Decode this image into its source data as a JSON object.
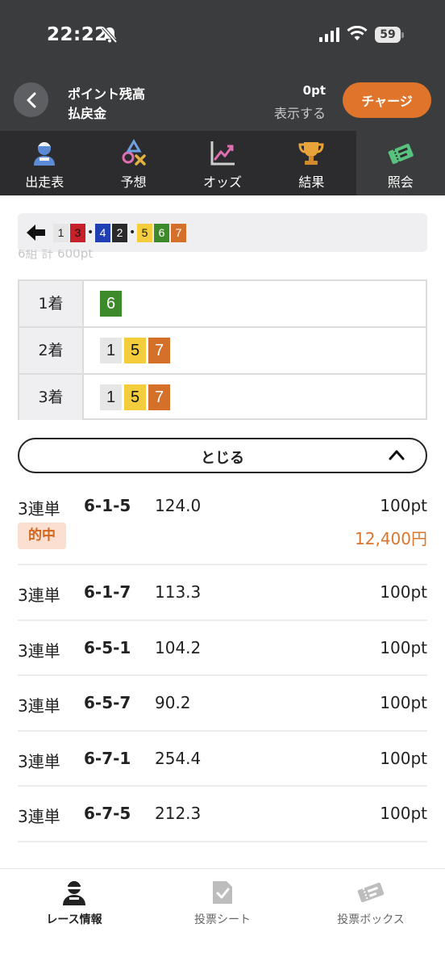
{
  "status_bar": {
    "time": "22:22",
    "battery": "59"
  },
  "header": {
    "point_label": "ポイント残高",
    "payout_label": "払戻金",
    "point_value": "0pt",
    "show_link": "表示する",
    "charge_button": "チャージ"
  },
  "tabs": [
    {
      "label": "出走表",
      "icon": "racer-icon"
    },
    {
      "label": "予想",
      "icon": "prediction-icon"
    },
    {
      "label": "オッズ",
      "icon": "odds-chart-icon"
    },
    {
      "label": "結果",
      "icon": "trophy-icon"
    },
    {
      "label": "照会",
      "icon": "ticket-icon",
      "active": true
    }
  ],
  "combo_bar": {
    "chips": [
      "1",
      "3",
      "4",
      "2",
      "5",
      "6",
      "7"
    ],
    "faded_text": "6組 計 600pt"
  },
  "results": {
    "rows": [
      {
        "place": "1着",
        "numbers": [
          "6"
        ]
      },
      {
        "place": "2着",
        "numbers": [
          "1",
          "5",
          "7"
        ]
      },
      {
        "place": "3着",
        "numbers": [
          "1",
          "5",
          "7"
        ]
      }
    ]
  },
  "close_button": "とじる",
  "bets": [
    {
      "type": "3連単",
      "combo": "6-1-5",
      "odds": "124.0",
      "amount": "100pt",
      "hit_label": "的中",
      "payout": "12,400円"
    },
    {
      "type": "3連単",
      "combo": "6-1-7",
      "odds": "113.3",
      "amount": "100pt"
    },
    {
      "type": "3連単",
      "combo": "6-5-1",
      "odds": "104.2",
      "amount": "100pt"
    },
    {
      "type": "3連単",
      "combo": "6-5-7",
      "odds": "90.2",
      "amount": "100pt"
    },
    {
      "type": "3連単",
      "combo": "6-7-1",
      "odds": "254.4",
      "amount": "100pt"
    },
    {
      "type": "3連単",
      "combo": "6-7-5",
      "odds": "212.3",
      "amount": "100pt"
    }
  ],
  "bottom_nav": [
    {
      "label": "レース情報",
      "icon": "racer-icon",
      "active": true
    },
    {
      "label": "投票シート",
      "icon": "vote-sheet-icon"
    },
    {
      "label": "投票ボックス",
      "icon": "ticket-box-icon"
    }
  ],
  "colors": {
    "boat_1": "#e6e6e6",
    "boat_2": "#2a2a2a",
    "boat_3": "#c8202a",
    "boat_4": "#1f3fb3",
    "boat_5": "#f3cd3b",
    "boat_6": "#3d8a2a",
    "boat_7": "#d4702a",
    "accent": "#e0742a"
  }
}
